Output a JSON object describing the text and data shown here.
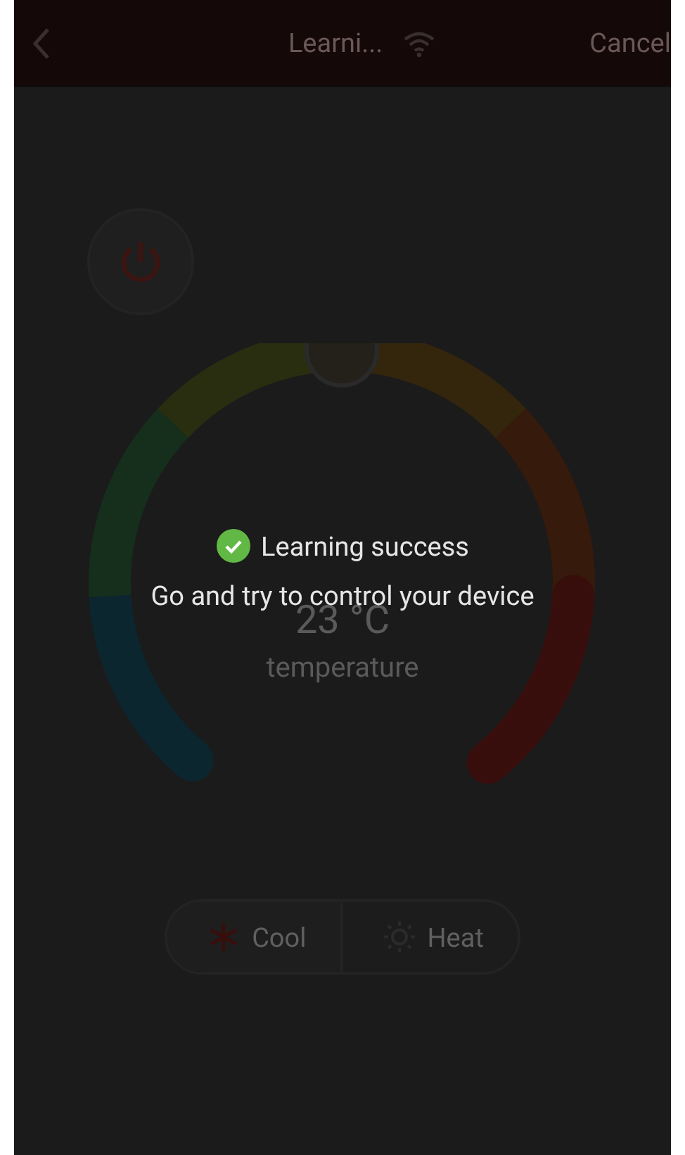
{
  "header": {
    "title": "Learni...",
    "action": "Cancel"
  },
  "power": {
    "on": false
  },
  "dial": {
    "temperature": "23 °C",
    "label": "temperature",
    "level": 0.5
  },
  "modes": [
    {
      "label": "Cool",
      "kind": "cool",
      "selected": true
    },
    {
      "label": "Heat",
      "kind": "heat",
      "selected": false
    }
  ],
  "toast": {
    "title": "Learning success",
    "message": "Go and try to control your device"
  }
}
